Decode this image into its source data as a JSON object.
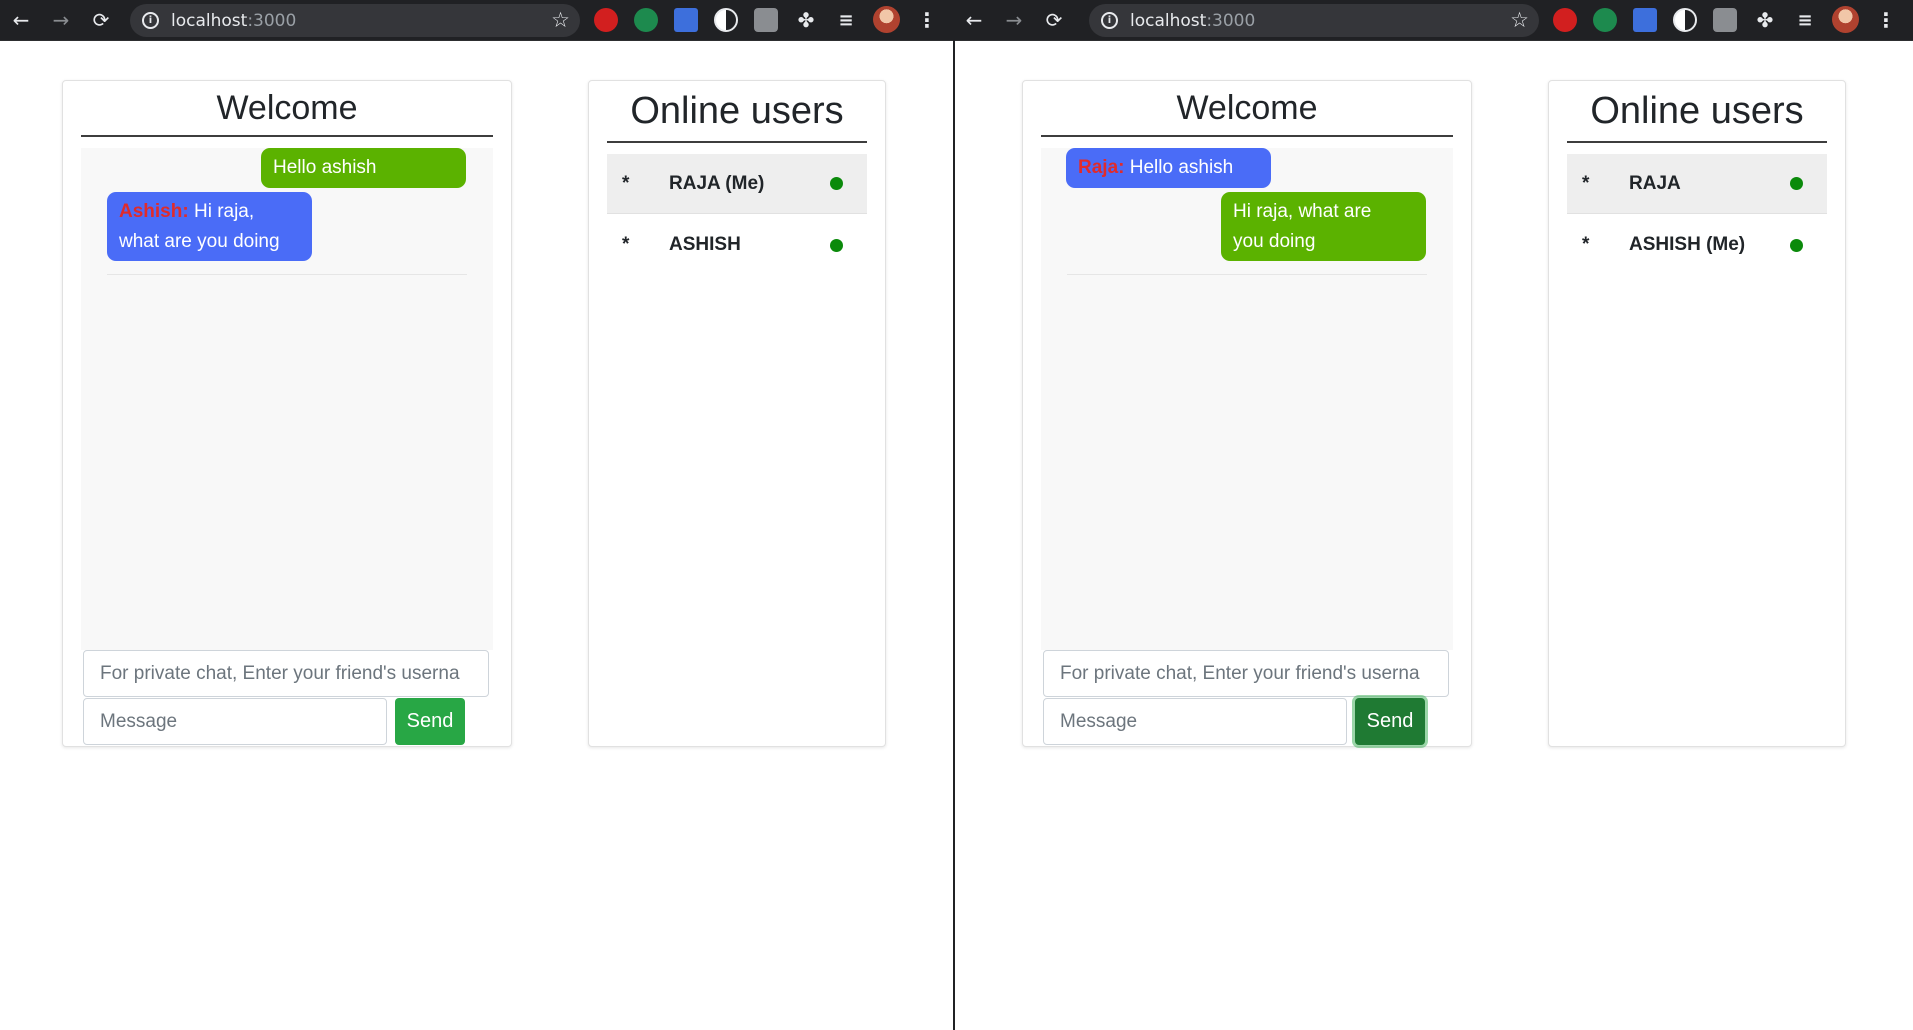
{
  "windows": [
    {
      "url_host": "localhost",
      "url_port": ":3000",
      "chat_title": "Welcome",
      "messages": [
        {
          "sender": "",
          "text": "Hello ashish"
        },
        {
          "sender": "Ashish:",
          "text": " Hi raja,",
          "line2": "what are you doing"
        }
      ],
      "private_placeholder": "For private chat, Enter your friend's userna",
      "message_placeholder": "Message",
      "send_label": "Send",
      "users_title": "Online users",
      "users": [
        {
          "bullet": "*",
          "name": "RAJA (Me)"
        },
        {
          "bullet": "*",
          "name": "ASHISH"
        }
      ]
    },
    {
      "url_host": "localhost",
      "url_port": ":3000",
      "chat_title": "Welcome",
      "messages": [
        {
          "sender": "Raja:",
          "text": " Hello ashish"
        },
        {
          "sender": "",
          "text": "Hi raja, what are",
          "line2": "you doing"
        }
      ],
      "private_placeholder": "For private chat, Enter your friend's userna",
      "message_placeholder": "Message",
      "send_label": "Send",
      "users_title": "Online users",
      "users": [
        {
          "bullet": "*",
          "name": "RAJA"
        },
        {
          "bullet": "*",
          "name": "ASHISH (Me)"
        }
      ]
    }
  ],
  "icons": {
    "back": "←",
    "forward": "→",
    "reload": "⟳",
    "star": "☆",
    "puzzle": "✤",
    "playlist": "≡",
    "menu": "⋮"
  },
  "colors": {
    "sent_bubble": "#5bb200",
    "received_bubble": "#4a6cf7",
    "sender_name": "#e02b2b",
    "send_button": "#28a745",
    "online_dot": "#0b8a0b"
  }
}
